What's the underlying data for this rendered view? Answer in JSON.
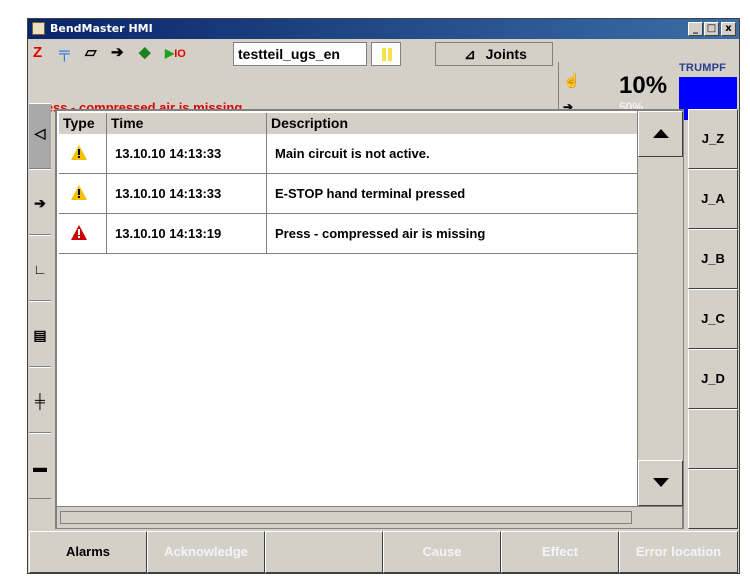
{
  "window": {
    "title": "BendMaster HMI",
    "min_btn": "_",
    "max_btn": "□",
    "close_btn": "x"
  },
  "toolbar": {
    "program_name": "testteil_ugs_en",
    "mode_label": "Joints",
    "io_label": "IO",
    "speed_main": "10%",
    "speed_secondary": "50%",
    "brand": "TRUMPF"
  },
  "message": {
    "text": "Press - compressed air is missing",
    "color": "#e00000"
  },
  "alarms": {
    "columns": [
      "Type",
      "Time",
      "Description"
    ],
    "rows": [
      {
        "type": "warning",
        "time": "13.10.10 14:13:33",
        "description": "Main circuit is not active."
      },
      {
        "type": "warning",
        "time": "13.10.10 14:13:33",
        "description": "E-STOP hand terminal pressed"
      },
      {
        "type": "error",
        "time": "13.10.10 14:13:19",
        "description": "Press - compressed air is missing"
      }
    ]
  },
  "joints": [
    "J_Z",
    "J_A",
    "J_B",
    "J_C",
    "J_D"
  ],
  "bottom": {
    "alarms": "Alarms",
    "acknowledge": "Acknowledge",
    "cause": "Cause",
    "effect": "Effect",
    "error_location": "Error location"
  },
  "colors": {
    "accent": "#0000ff",
    "warning": "#f2c200",
    "error": "#cc0000"
  }
}
